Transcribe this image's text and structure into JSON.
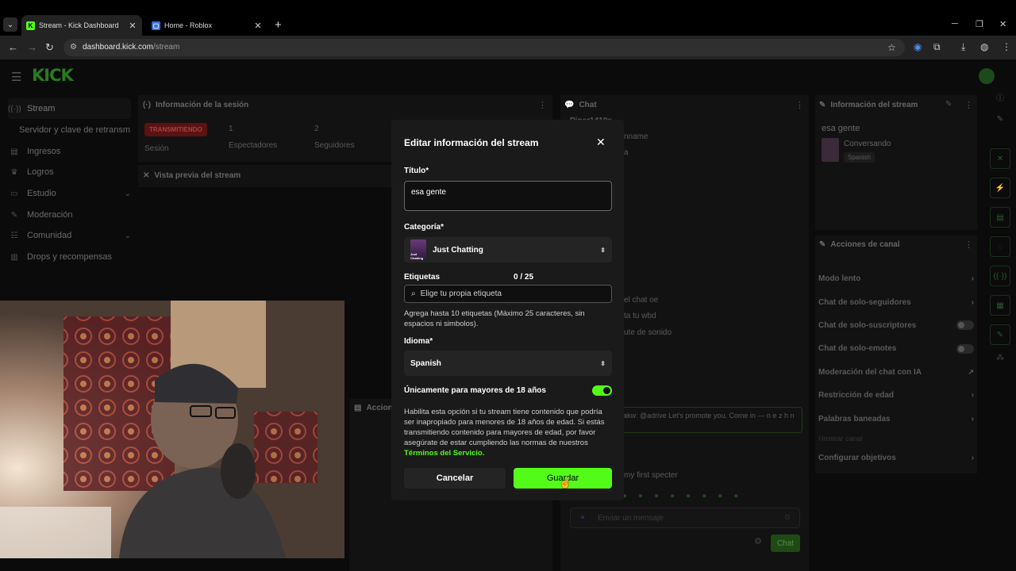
{
  "browser": {
    "tabs": [
      {
        "title": "Stream - Kick Dashboard",
        "active": true
      },
      {
        "title": "Home - Roblox",
        "active": false
      }
    ],
    "url_host": "dashboard.kick.com",
    "url_path": "/stream"
  },
  "app": {
    "logo": "KICK",
    "sidebar": {
      "items": [
        {
          "label": "Stream",
          "icon": "broadcast-icon"
        },
        {
          "label": "Servidor y clave de retransm",
          "icon": ""
        },
        {
          "label": "Ingresos",
          "icon": "money-icon"
        },
        {
          "label": "Logros",
          "icon": "trophy-icon"
        },
        {
          "label": "Estudio",
          "icon": "studio-icon"
        },
        {
          "label": "Moderación",
          "icon": "wrench-icon"
        },
        {
          "label": "Comunidad",
          "icon": "community-icon"
        },
        {
          "label": "Drops y recompensas",
          "icon": "drops-icon"
        }
      ]
    },
    "session": {
      "header": "Información de la sesión",
      "live_badge": "TRANSMITIENDO",
      "session_label": "Sesión",
      "viewers_value": "1",
      "viewers_label": "Espectadores",
      "followers_value": "2",
      "followers_label": "Seguidores"
    },
    "preview_header": "Vista previa del stream",
    "actions_header": "Accion",
    "chat": {
      "header": "Chat",
      "user": "Piper1410x",
      "msg1": "nname",
      "msg2": "a",
      "msg3": "el chat oe",
      "msg4": "ta tu wbd",
      "msg5": "ute de sonido",
      "promo": "akw: @adrive Let's promote you. Come in — n e z h n",
      "host_hint": "Hostear canal",
      "first": "my first specter",
      "input_placeholder": "Enviar un mensaje",
      "send_label": "Chat"
    },
    "stream_info": {
      "header": "Información del stream",
      "title": "esa gente",
      "category": "Conversando",
      "language_tag": "Spanish"
    },
    "channel_actions": {
      "header": "Acciones de canal",
      "items": [
        {
          "label": "Modo lento"
        },
        {
          "label": "Chat de solo-seguidores"
        },
        {
          "label": "Chat de solo-suscriptores"
        },
        {
          "label": "Chat de solo-emotes"
        },
        {
          "label": "Moderación del chat con IA"
        },
        {
          "label": "Restricción de edad"
        },
        {
          "label": "Palabras baneadas"
        },
        {
          "label": "Hostear canal"
        },
        {
          "label": "Configurar objetivos"
        }
      ]
    }
  },
  "modal": {
    "title": "Editar información del stream",
    "title_label": "Título*",
    "title_value": "esa gente",
    "category_label": "Categoría*",
    "category_value": "Just Chatting",
    "category_thumb_text": "Just Chatting",
    "tags_label": "Etiquetas",
    "tags_count": "0 / 25",
    "tags_placeholder": "Elige tu propia etiqueta",
    "tags_help": "Agrega hasta 10 etiquetas (Máximo 25 caracteres, sin espacios ni simbolos).",
    "language_label": "Idioma*",
    "language_value": "Spanish",
    "mature_label": "Únicamente para mayores de 18 años",
    "mature_on": true,
    "mature_help": "Habilita esta opción si tu stream tiene contenido que podría ser inapropiado para menores de 18 años de edad. Si estás transmitiendo contenido para mayores de edad, por favor asegúrate de estar cumpliendo las normas de nuestros",
    "terms_link": "Términos del Servicio.",
    "cancel_label": "Cancelar",
    "save_label": "Guardar"
  },
  "colors": {
    "accent": "#53fc18",
    "modal_bg": "#1a1a1a",
    "page_bg": "#0b0b0b"
  }
}
